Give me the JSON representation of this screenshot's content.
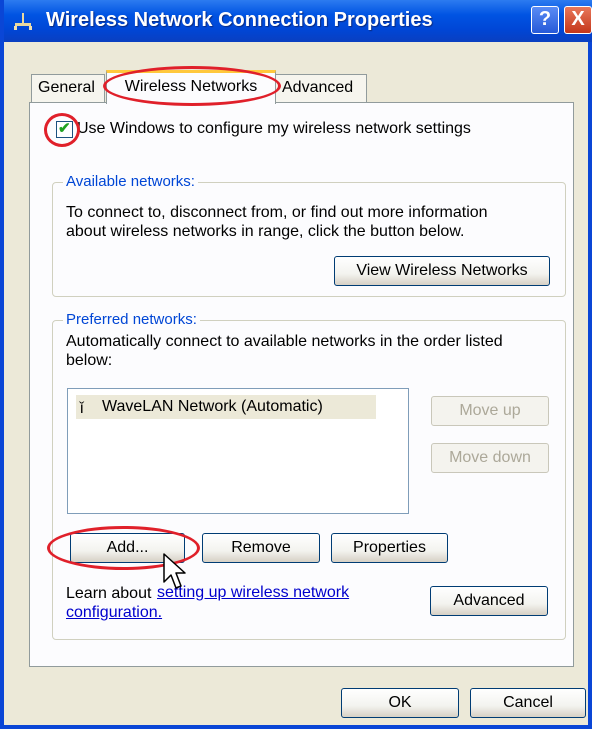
{
  "window": {
    "title": "Wireless Network Connection Properties",
    "help_label": "?",
    "close_label": "X"
  },
  "tabs": [
    {
      "label": "General"
    },
    {
      "label": "Wireless Networks"
    },
    {
      "label": "Advanced"
    }
  ],
  "checkbox": {
    "label": "Use Windows to configure my wireless network settings",
    "checked": true
  },
  "available": {
    "title": "Available networks:",
    "description_line1": "To connect to, disconnect from, or find out more information",
    "description_line2": "about wireless networks in range, click the button below.",
    "view_button": "View Wireless Networks"
  },
  "preferred": {
    "title": "Preferred networks:",
    "description_line1": "Automatically connect to available networks in the order listed",
    "description_line2": "below:",
    "list": [
      {
        "label": "WaveLAN Network (Automatic)",
        "icon": "antenna-icon"
      }
    ],
    "move_up": "Move up",
    "move_down": "Move down",
    "add": "Add...",
    "remove": "Remove",
    "properties": "Properties",
    "learn_prefix": "Learn about ",
    "learn_link_line1": "setting up wireless network",
    "learn_link_line2": "configuration.",
    "advanced": "Advanced"
  },
  "footer": {
    "ok": "OK",
    "cancel": "Cancel"
  },
  "colors": {
    "titlebar": "#0054E3",
    "highlight_oval": "#E0202A",
    "tab_accent": "#FFC83C",
    "dialog_bg": "#ECE9D8"
  }
}
